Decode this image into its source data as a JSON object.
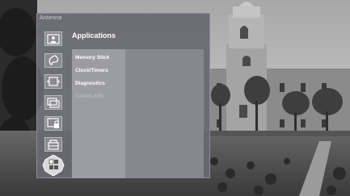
{
  "menu": {
    "input_label": "Antenna",
    "section_title": "Applications",
    "items": [
      {
        "label": "Memory Stick"
      },
      {
        "label": "Clock/Timers"
      },
      {
        "label": "Diagnostics"
      },
      {
        "label": "CableCARD",
        "disabled": true
      }
    ],
    "categories": [
      {
        "icon": "picture-icon"
      },
      {
        "icon": "sound-icon"
      },
      {
        "icon": "screen-icon"
      },
      {
        "icon": "channel-icon"
      },
      {
        "icon": "parental-lock-icon"
      },
      {
        "icon": "setup-icon"
      },
      {
        "icon": "applications-icon",
        "selected": true
      }
    ]
  },
  "colors": {
    "panel": "#686870",
    "list_column": "#9c9ca4",
    "list_panel": "#878790",
    "text": "#ffffff",
    "disabled_text": "#b7b7c0"
  }
}
